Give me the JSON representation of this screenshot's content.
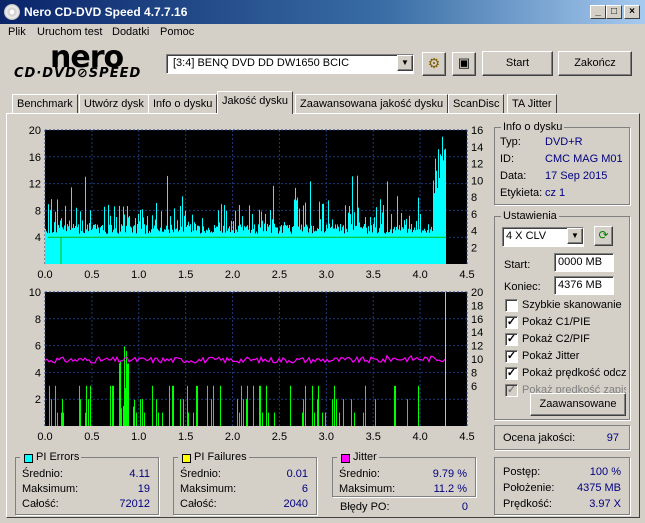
{
  "window": {
    "title": "Nero CD-DVD Speed 4.7.7.16",
    "min": "_",
    "max": "□",
    "close": "×"
  },
  "menu": [
    "Plik",
    "Uruchom test",
    "Dodatki",
    "Pomoc"
  ],
  "logo": {
    "top": "nero",
    "bottom": "CD·DVD⊘SPEED"
  },
  "drive": {
    "selected": "[3:4]   BENQ DVD DD DW1650 BCIC"
  },
  "buttons": {
    "start": "Start",
    "close": "Zakończ",
    "advanced": "Zaawansowane"
  },
  "tabs": [
    "Benchmark",
    "Utwórz dysk",
    "Info o dysku",
    "Jakość dysku",
    "Zaawansowana jakość dysku",
    "ScanDisc",
    "TA Jitter"
  ],
  "active_tab": "Jakość dysku",
  "disc_info": {
    "title": "Info o dysku",
    "type_label": "Typ:",
    "type": "DVD+R",
    "id_label": "ID:",
    "id": "CMC MAG M01",
    "date_label": "Data:",
    "date": "17 Sep 2015",
    "label_label": "Etykieta:",
    "label": "cz 1"
  },
  "settings": {
    "title": "Ustawienia",
    "speed": "4 X CLV",
    "start_label": "Start:",
    "start": "0000 MB",
    "end_label": "Koniec:",
    "end": "4376 MB",
    "options": [
      {
        "label": "Szybkie skanowanie",
        "checked": false,
        "disabled": false
      },
      {
        "label": "Pokaż C1/PIE",
        "checked": true,
        "disabled": false
      },
      {
        "label": "Pokaż C2/PIF",
        "checked": true,
        "disabled": false
      },
      {
        "label": "Pokaż Jitter",
        "checked": true,
        "disabled": false
      },
      {
        "label": "Pokaż prędkość odczytu",
        "checked": true,
        "disabled": false
      },
      {
        "label": "Pokaż prędkość zapisu",
        "checked": true,
        "disabled": true
      }
    ]
  },
  "quality": {
    "label": "Ocena jakości:",
    "value": "97"
  },
  "pi_errors": {
    "title": "PI Errors",
    "avg_label": "Średnio:",
    "avg": "4.11",
    "max_label": "Maksimum:",
    "max": "19",
    "total_label": "Całość:",
    "total": "72012",
    "color": "#00ffff"
  },
  "pi_failures": {
    "title": "PI Failures",
    "avg_label": "Średnio:",
    "avg": "0.01",
    "max_label": "Maksimum:",
    "max": "6",
    "total_label": "Całość:",
    "total": "2040",
    "color": "#ffff00"
  },
  "jitter": {
    "title": "Jitter",
    "avg_label": "Średnio:",
    "avg": "9.79 %",
    "max_label": "Maksimum:",
    "max": "11.2 %",
    "po_label": "Błędy PO:",
    "po": "0",
    "color": "#ff00ff"
  },
  "progress": {
    "progress_label": "Postęp:",
    "progress": "100 %",
    "position_label": "Położenie:",
    "position": "4375 MB",
    "speed_label": "Prędkość:",
    "speed": "3.97 X"
  },
  "chart_data": [
    {
      "type": "bar",
      "name": "PI Errors",
      "x_ticks": [
        "0.0",
        "0.5",
        "1.0",
        "1.5",
        "2.0",
        "2.5",
        "3.0",
        "3.5",
        "4.0",
        "4.5"
      ],
      "xlim": [
        0,
        4.5
      ],
      "y_left_ticks": [
        "20",
        "16",
        "12",
        "8",
        "4"
      ],
      "ylim_left": [
        0,
        20
      ],
      "y_right_ticks": [
        "16",
        "14",
        "12",
        "10",
        "8",
        "6",
        "4",
        "2"
      ],
      "ylim_right": [
        0,
        16
      ],
      "series": [
        {
          "name": "PI Errors",
          "color": "#00ffff",
          "baseline": 4.5,
          "typical_peak": 10,
          "max": 19
        },
        {
          "name": "Read speed",
          "color": "#00c000",
          "value": 4
        }
      ]
    },
    {
      "type": "bar",
      "name": "PI Failures / Jitter",
      "x_ticks": [
        "0.0",
        "0.5",
        "1.0",
        "1.5",
        "2.0",
        "2.5",
        "3.0",
        "3.5",
        "4.0",
        "4.5"
      ],
      "xlim": [
        0,
        4.5
      ],
      "y_left_ticks": [
        "10",
        "8",
        "6",
        "4",
        "2"
      ],
      "ylim_left": [
        0,
        10
      ],
      "y_right_ticks": [
        "20",
        "18",
        "16",
        "14",
        "12",
        "10",
        "8",
        "6"
      ],
      "ylim_right": [
        0,
        20
      ],
      "series": [
        {
          "name": "PI Failures",
          "color": "#00ff00",
          "max": 6
        },
        {
          "name": "Jitter",
          "color": "#ff00ff",
          "avg": 9.79,
          "max": 11.2
        }
      ]
    }
  ]
}
